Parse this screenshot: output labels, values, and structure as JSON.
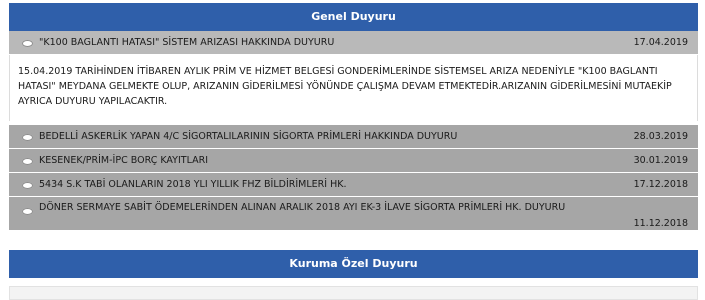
{
  "genel": {
    "title": "Genel Duyuru",
    "items": [
      {
        "title": "\"K100 BAGLANTI HATASI\" SİSTEM ARIZASI HAKKINDA DUYURU",
        "date": "17.04.2019",
        "body": "15.04.2019 TARİHİNDEN İTİBAREN AYLIK PRİM VE HİZMET BELGESİ GONDERİMLERİNDE SİSTEMSEL ARIZA NEDENİYLE \"K100 BAGLANTI HATASI\" MEYDANA GELMEKTE OLUP, ARIZANIN GİDERİLMESİ YÖNÜNDE ÇALIŞMA DEVAM ETMEKTEDİR.ARIZANIN GİDERİLMESİNİ MUTAEKİP AYRICA DUYURU YAPILACAKTIR."
      },
      {
        "title": "BEDELLİ ASKERLİK YAPAN 4/C SİGORTALILARININ SİGORTA PRİMLERİ HAKKINDA DUYURU",
        "date": "28.03.2019"
      },
      {
        "title": "KESENEK/PRİM-İPC BORÇ KAYITLARI",
        "date": "30.01.2019"
      },
      {
        "title": "5434 S.K TABİ OLANLARIN 2018 YLI YILLIK FHZ BİLDİRİMLERİ HK.",
        "date": "17.12.2018"
      },
      {
        "title": "DÖNER SERMAYE SABİT ÖDEMELERİNDEN ALINAN ARALIK 2018 AYI EK-3 İLAVE SİGORTA PRİMLERİ HK. DUYURU",
        "date": "11.12.2018"
      }
    ]
  },
  "kurum": {
    "title": "Kuruma Özel Duyuru"
  },
  "colors": {
    "header_bg": "#2f5faa",
    "item_bg": "#a6a6a6"
  }
}
